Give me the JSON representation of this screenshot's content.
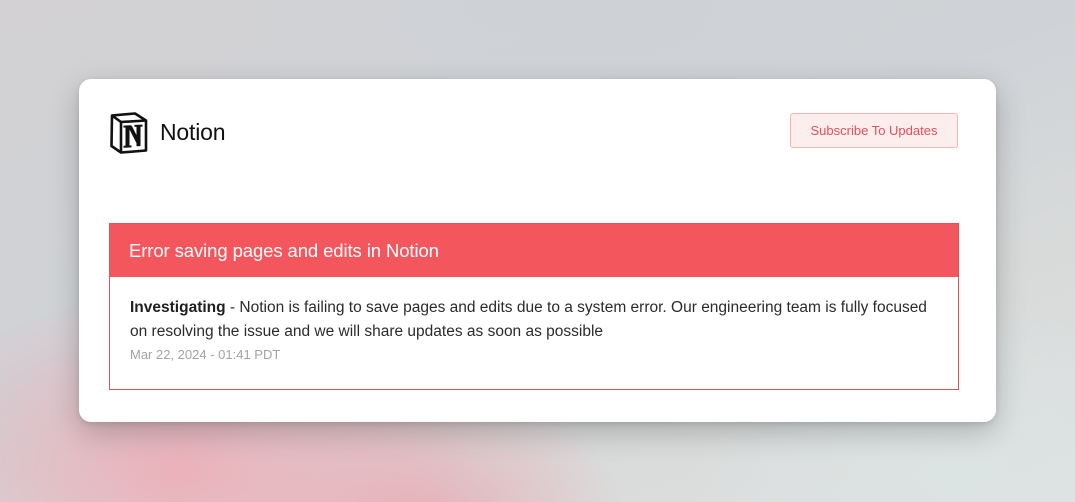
{
  "brand": {
    "name": "Notion",
    "logo_icon": "notion-logo-icon"
  },
  "header": {
    "subscribe_label": "Subscribe To Updates"
  },
  "incident": {
    "title": "Error saving pages and edits in Notion",
    "updates": [
      {
        "status": "Investigating",
        "separator": " - ",
        "message": "Notion is failing to save pages and edits due to a system error. Our engineering team is fully focused on resolving the issue and we will share updates as soon as possible",
        "timestamp": "Mar 22, 2024 - 01:41 PDT"
      }
    ]
  },
  "colors": {
    "accent": "#f4565d",
    "accent_border": "#e34f5a",
    "subscribe_text": "#e5505a",
    "subscribe_bg": "#fdeeee",
    "subscribe_border": "#f5b4b6",
    "timestamp": "#a3a3a3"
  }
}
